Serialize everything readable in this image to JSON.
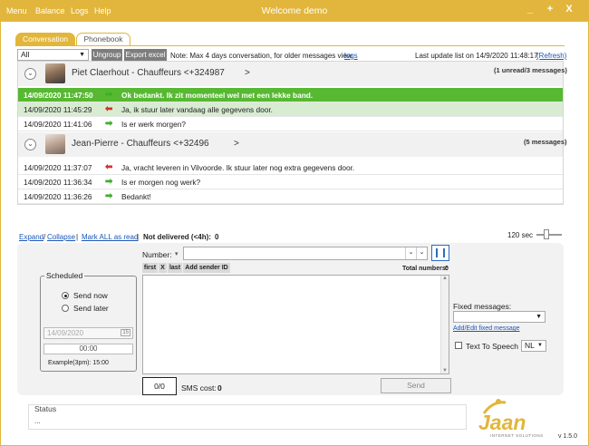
{
  "titlebar": {
    "menus": [
      "Menu",
      "Balance",
      "Logs",
      "Help"
    ],
    "title": "Welcome demo",
    "minimize": "_",
    "maximize": "+",
    "close": "X"
  },
  "tabs": [
    "Conversation",
    "Phonebook"
  ],
  "toolbar": {
    "filter_value": "All",
    "ungroup": "Ungroup",
    "export": "Export excel",
    "note": "Note: Max 4 days conversation, for older messages view",
    "logs_link": "logs",
    "last_update": "Last update list on 14/9/2020 11:48:17",
    "refresh": "(Refresh)"
  },
  "conversations": [
    {
      "name": "Piet Claerhout - Chauffeurs <+324987",
      "name_end": ">",
      "count": "(1 unread/3 messages)",
      "messages": [
        {
          "time": "14/09/2020 11:47:50",
          "dir": "in",
          "text": "Ok bedankt. Ik zit momenteel wel met een lekke band."
        },
        {
          "time": "14/09/2020 11:45:29",
          "dir": "out",
          "text": "Ja, ik stuur later vandaag alle gegevens door."
        },
        {
          "time": "14/09/2020 11:41:06",
          "dir": "in",
          "text": "Is er werk morgen?"
        }
      ]
    },
    {
      "name": "Jean-Pierre - Chauffeurs <+32496",
      "name_end": ">",
      "count": "(5 messages)",
      "messages": [
        {
          "time": "14/09/2020 11:37:07",
          "dir": "out",
          "text": "Ja, vracht leveren in Vilvoorde. Ik stuur later nog extra gegevens door."
        },
        {
          "time": "14/09/2020 11:36:34",
          "dir": "in",
          "text": "Is er morgen nog werk?"
        },
        {
          "time": "14/09/2020 11:36:26",
          "dir": "in",
          "text": "Bedankt!"
        }
      ]
    }
  ],
  "actions": {
    "expand": "Expand",
    "sep": "/",
    "collapse": "Collapse",
    "pipe1": "|",
    "mark_all": "Mark ALL as read",
    "pipe2": "|",
    "not_delivered_label": "Not delivered (<4h):",
    "not_delivered_value": "0",
    "interval": "120 sec"
  },
  "composer": {
    "number_label": "Number:",
    "columns": [
      "first",
      "X",
      "last",
      "Add sender ID"
    ],
    "total_label": "Total numbers:",
    "total_value": "0",
    "scheduled_title": "Scheduled",
    "send_now": "Send now",
    "send_later": "Send later",
    "date_placeholder": "14/09/2020",
    "calendar_day": "15",
    "time_value": "00:00",
    "example": "Example(3pm): 15:00",
    "char_count": "0/0",
    "sms_cost_label": "SMS cost:",
    "sms_cost_value": "0",
    "send": "Send",
    "fixed_label": "Fixed messages:",
    "fixed_link": "Add/Edit fixed message",
    "tts_label": "Text To Speech",
    "tts_lang": "NL"
  },
  "status": {
    "label": "Status",
    "value": "...",
    "logo_text": "Jaan",
    "logo_sub": "INTERNET SOLUTIONS",
    "version": "v 1.5.0"
  },
  "colors": {
    "accent": "#e2b63c",
    "unread": "#57b832",
    "incoming_arrow": "#3fae2a",
    "outgoing_arrow": "#d9302b",
    "link": "#1a56b8"
  }
}
